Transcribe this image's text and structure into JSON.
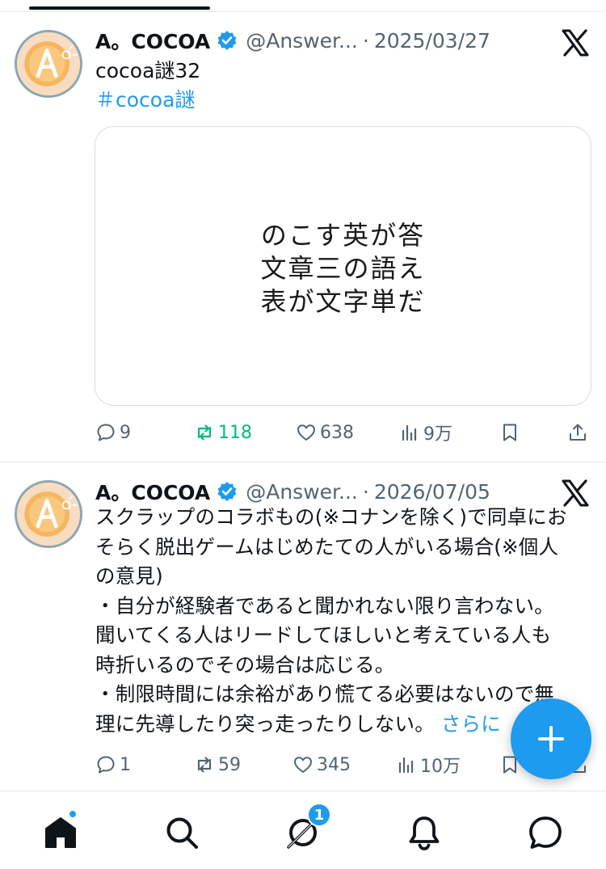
{
  "posts": [
    {
      "author_name": "A。COCOA",
      "verified": true,
      "handle": "@Answer...",
      "separator": "·",
      "date": "2025/03/27",
      "text": "cocoa謎32",
      "hashtag": "＃cocoa謎",
      "media_lines": [
        "のこす英が答",
        "文章三の語え",
        "表が文字単だ"
      ],
      "replies": "9",
      "reposts": "118",
      "likes": "638",
      "views": "9万"
    },
    {
      "author_name": "A。COCOA",
      "verified": true,
      "handle": "@Answer...",
      "separator": "·",
      "date": "2026/07/05",
      "text": "スクラップのコラボもの(※コナンを除く)で同卓にお\nそらく脱出ゲームはじめたての人がいる場合(※個人\nの意見)\n・自分が経験者であると聞かれない限り言わない。\n聞いてくる人はリードしてほしいと考えている人も\n時折いるのでその場合は応じる。\n・制限時間には余裕があり慌てる必要はないので無\n理に先導したり突っ走ったりしない。",
      "more_label": "さらに",
      "replies": "1",
      "reposts": "59",
      "likes": "345",
      "views": "10万"
    }
  ],
  "tabbar": {
    "items": [
      "home-icon",
      "search-icon",
      "grok-icon",
      "notifications-icon",
      "messages-icon"
    ],
    "grok_badge": "1"
  },
  "colors": {
    "accent": "#1d9bf0",
    "repost_active": "#00ba7c",
    "muted": "#536471",
    "text": "#0f1419"
  }
}
